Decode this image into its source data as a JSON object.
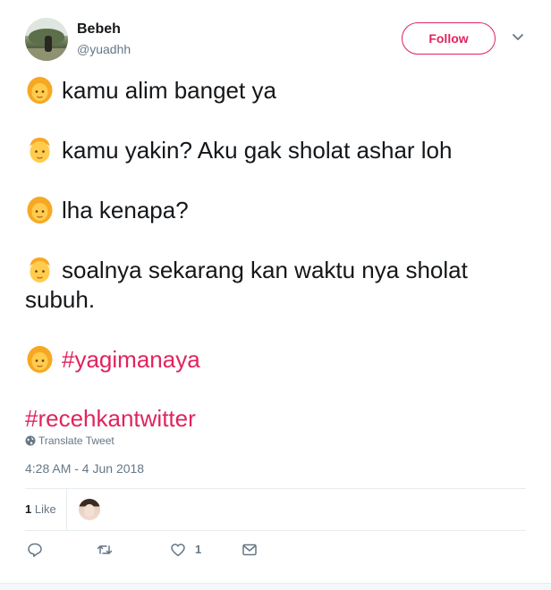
{
  "author": {
    "display_name": "Bebeh",
    "handle": "@yuadhh",
    "follow_label": "Follow"
  },
  "lines": [
    {
      "emoji": "woman-emoji",
      "text": "kamu alim banget ya"
    },
    {
      "emoji": "man-emoji",
      "text": "kamu yakin? Aku gak sholat ashar loh"
    },
    {
      "emoji": "woman-emoji",
      "text": "lha kenapa?"
    },
    {
      "emoji": "man-emoji",
      "text": "soalnya sekarang kan waktu nya sholat subuh."
    },
    {
      "emoji": "woman-emoji",
      "hashtag": "#yagimanaya"
    },
    {
      "hashtag": "#recehkantwitter"
    }
  ],
  "translate_label": "Translate Tweet",
  "timestamp": "4:28 AM - 4 Jun 2018",
  "stats": {
    "likes_number": "1",
    "likes_label": "Like"
  },
  "actions": {
    "reply_icon": "reply-icon",
    "retweet_icon": "retweet-icon",
    "like_icon": "heart-icon",
    "like_count": "1",
    "dm_icon": "envelope-icon"
  },
  "colors": {
    "accent": "#e0245e",
    "text": "#14171a",
    "muted": "#657786"
  }
}
